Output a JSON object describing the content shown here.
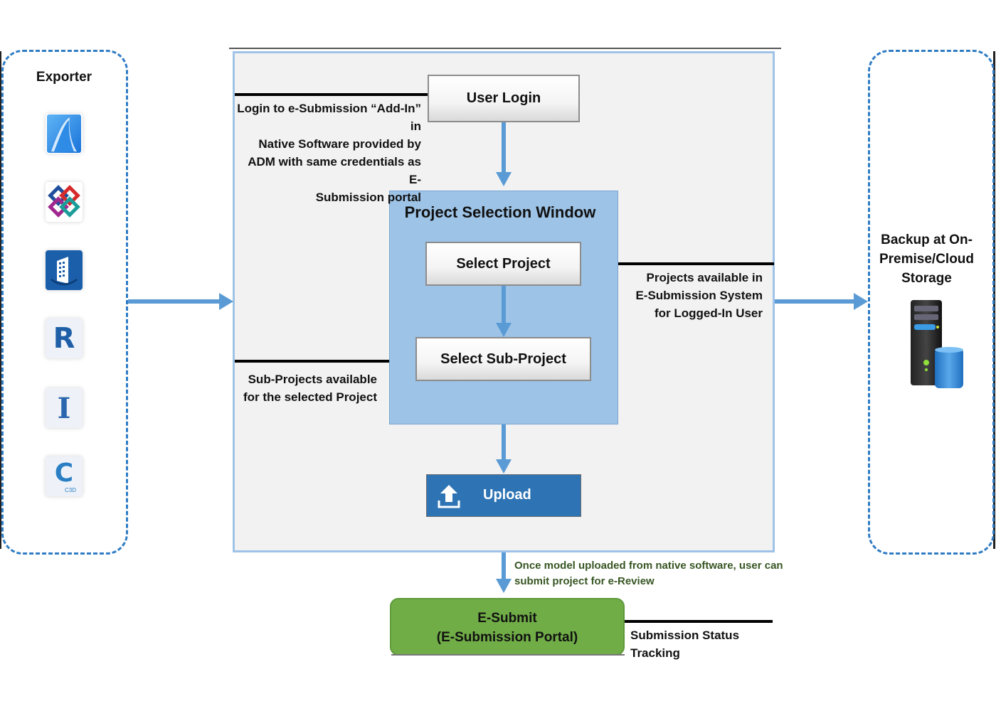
{
  "diagram": {
    "exporter_panel": {
      "title": "Exporter",
      "apps": [
        {
          "name": "ArchiCAD",
          "icon": "archicad-icon"
        },
        {
          "name": "IFC",
          "icon": "ifc-icon"
        },
        {
          "name": "OpenBuildings",
          "icon": "openbuildings-icon"
        },
        {
          "name": "Revit",
          "icon": "revit-icon",
          "glyph": "R"
        },
        {
          "name": "Infraworks",
          "icon": "infraworks-icon",
          "glyph": "I"
        },
        {
          "name": "Civil 3D",
          "icon": "civil3d-icon",
          "glyph": "C",
          "sub": "C3D"
        }
      ]
    },
    "backup_panel": {
      "title_lines": [
        "Backup at On-",
        "Premise/Cloud",
        "Storage"
      ],
      "icon": "server-storage-icon"
    },
    "flow": {
      "user_login": "User Login",
      "login_note_lines": [
        "Login to e-Submission “Add-In” in",
        "Native Software provided by",
        "ADM with same credentials as E-",
        "Submission portal"
      ],
      "project_selection_title": "Project Selection Window",
      "select_project": "Select Project",
      "projects_note_lines": [
        "Projects available in",
        "E-Submission System",
        "for Logged-In User"
      ],
      "select_sub_project": "Select Sub-Project",
      "subprojects_note_lines": [
        "Sub-Projects available",
        "for the selected Project"
      ],
      "upload": "Upload",
      "upload_icon": "upload-icon",
      "upload_note_lines": [
        "Once model uploaded from native software, user can",
        "submit project for e-Review"
      ],
      "esubmit_lines": [
        "E-Submit",
        "(E-Submission Portal)"
      ],
      "status_note": "Submission Status Tracking"
    },
    "colors": {
      "arrow": "#5b9bd5",
      "dashed_border": "#2f7cc4",
      "panel_bg": "#f2f2f2",
      "psw_bg": "#9dc3e6",
      "upload_bg": "#2e74b5",
      "esubmit_bg": "#70ad47",
      "green_note": "#375623"
    }
  }
}
